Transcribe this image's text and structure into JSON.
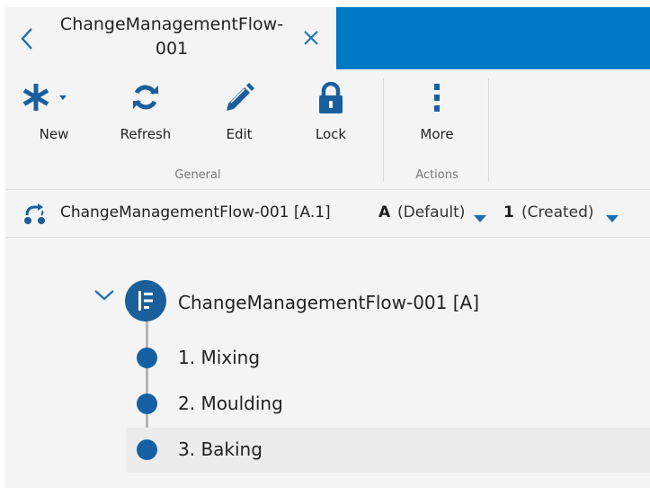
{
  "tab": {
    "title_line1": "ChangeManagementFlow-",
    "title_line2": "001",
    "back_icon": "chevron-left-icon",
    "close_icon": "close-icon"
  },
  "ribbon": {
    "groups": [
      {
        "label": "General",
        "buttons": [
          {
            "label": "New",
            "icon": "asterisk-icon"
          },
          {
            "label": "Refresh",
            "icon": "refresh-icon"
          },
          {
            "label": "Edit",
            "icon": "pencil-icon"
          },
          {
            "label": "Lock",
            "icon": "lock-icon"
          }
        ]
      },
      {
        "label": "Actions",
        "buttons": [
          {
            "label": "More",
            "icon": "more-vertical-icon"
          }
        ]
      }
    ]
  },
  "infobar": {
    "path": "ChangeManagementFlow-001 [A.1]",
    "revision_letter": "A",
    "revision_state": "(Default)",
    "version_number": "1",
    "version_state": "(Created)"
  },
  "tree": {
    "root_label": "ChangeManagementFlow-001 [A]",
    "steps": [
      "1. Mixing",
      "2. Moulding",
      "3. Baking"
    ]
  },
  "colors": {
    "accent_blue": "#0078c8",
    "icon_blue": "#1a5f9c",
    "background": "#f4f4f4"
  }
}
